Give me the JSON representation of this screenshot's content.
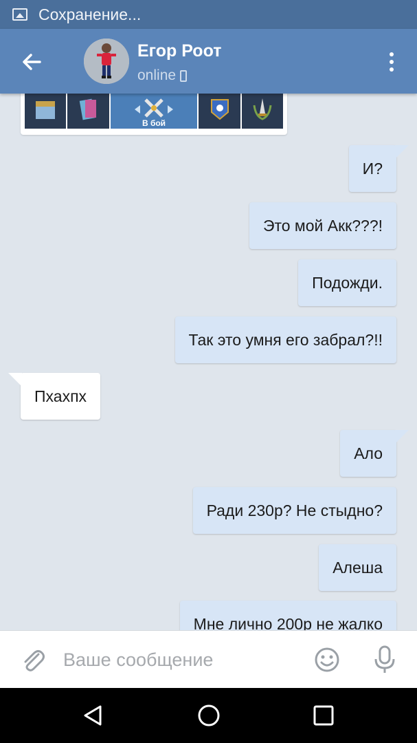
{
  "status_bar": {
    "text": "Сохранение..."
  },
  "header": {
    "name": "Егор Роот",
    "status": "online"
  },
  "attachment": {
    "button_label": "В бой"
  },
  "messages": [
    {
      "text": "И?",
      "direction": "out"
    },
    {
      "text": "Это мой Акк???!",
      "direction": "out"
    },
    {
      "text": "Подожди.",
      "direction": "out"
    },
    {
      "text": "Так это умня его забрал?!!",
      "direction": "out"
    },
    {
      "text": "Пхахпх",
      "direction": "in"
    },
    {
      "text": "Ало",
      "direction": "out"
    },
    {
      "text": "Ради 230р? Не стыдно?",
      "direction": "out"
    },
    {
      "text": "Алеша",
      "direction": "out"
    },
    {
      "text": "Мне лично 200р не жалко",
      "direction": "out"
    }
  ],
  "input": {
    "placeholder": "Ваше сообщение",
    "value": ""
  },
  "colors": {
    "header": "#5b85b9",
    "status_bar": "#4a6f9b",
    "outgoing_bubble": "#d7e5f6",
    "incoming_bubble": "#ffffff",
    "chat_bg": "#dfe5ec"
  },
  "icons": [
    "image-icon",
    "back-arrow-icon",
    "phone-icon",
    "more-vert-icon",
    "paperclip-icon",
    "emoji-icon",
    "microphone-icon",
    "nav-back-icon",
    "nav-home-icon",
    "nav-recents-icon"
  ]
}
